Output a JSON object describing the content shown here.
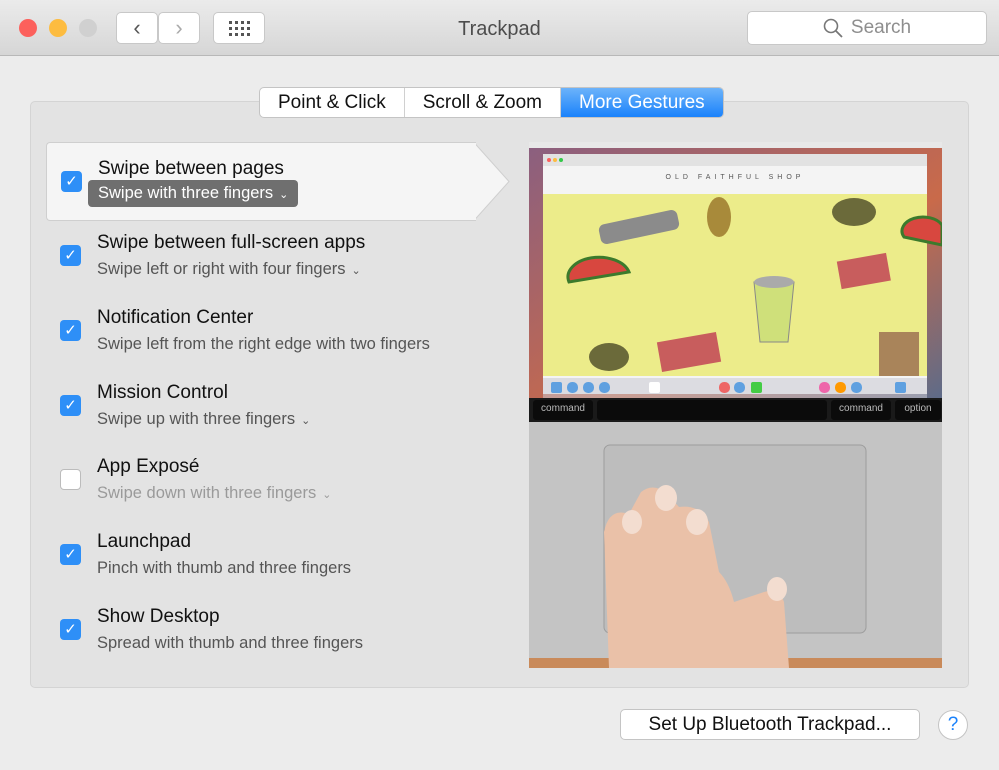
{
  "window": {
    "title": "Trackpad",
    "search_placeholder": "Search"
  },
  "tabs": [
    {
      "label": "Point & Click"
    },
    {
      "label": "Scroll & Zoom"
    },
    {
      "label": "More Gestures",
      "active": true
    }
  ],
  "gestures": [
    {
      "label": "Swipe between pages",
      "sub": "Swipe with three fingers",
      "checked": true,
      "dropdown": true,
      "selected": true
    },
    {
      "label": "Swipe between full-screen apps",
      "sub": "Swipe left or right with four fingers",
      "checked": true,
      "dropdown": true
    },
    {
      "label": "Notification Center",
      "sub": "Swipe left from the right edge with two fingers",
      "checked": true,
      "dropdown": false
    },
    {
      "label": "Mission Control",
      "sub": "Swipe up with three fingers",
      "checked": true,
      "dropdown": true
    },
    {
      "label": "App Exposé",
      "sub": "Swipe down with three fingers",
      "checked": false,
      "dropdown": true
    },
    {
      "label": "Launchpad",
      "sub": "Pinch with thumb and three fingers",
      "checked": true,
      "dropdown": false
    },
    {
      "label": "Show Desktop",
      "sub": "Spread with thumb and three fingers",
      "checked": true,
      "dropdown": false
    }
  ],
  "preview": {
    "shop_title": "OLD FAITHFUL SHOP",
    "key_left": "command",
    "key_right": "command",
    "key_option": "option"
  },
  "footer": {
    "bluetooth_button": "Set Up Bluetooth Trackpad...",
    "help": "?"
  },
  "colors": {
    "accent": "#1a82fb",
    "close": "#fc605c",
    "minimize": "#fdbc40",
    "zoom": "#cfcfcf"
  }
}
